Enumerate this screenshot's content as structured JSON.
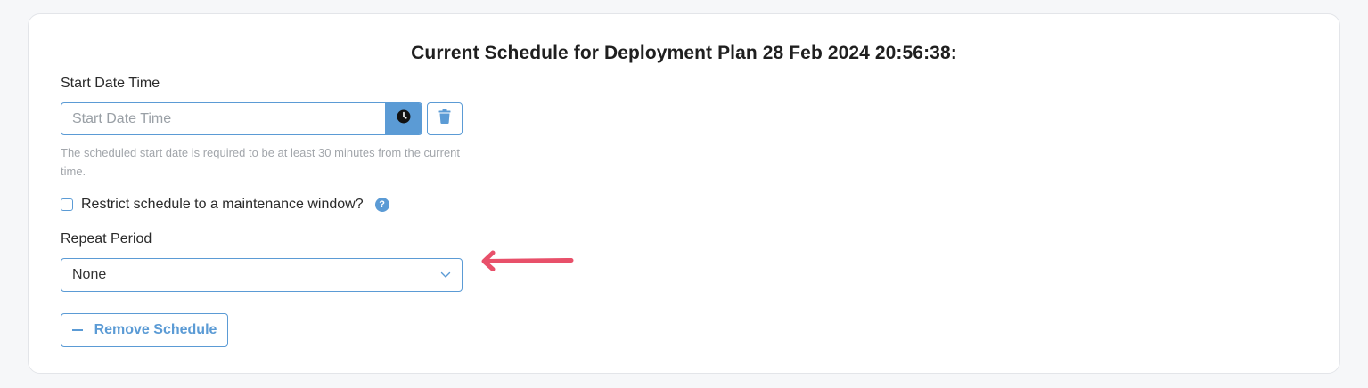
{
  "page": {
    "title": "Current Schedule for Deployment Plan 28 Feb 2024 20:56:38:"
  },
  "start_date": {
    "label": "Start Date Time",
    "placeholder": "Start Date Time",
    "value": "",
    "clock_icon": "clock-icon",
    "trash_icon": "trash-icon",
    "help_text": "The scheduled start date is required to be at least 30 minutes from the current time."
  },
  "maintenance": {
    "label": "Restrict schedule to a maintenance window?",
    "checked": false,
    "help_icon": "question-circle-icon",
    "help_glyph": "?"
  },
  "repeat": {
    "label": "Repeat Period",
    "value": "None",
    "chevron_icon": "chevron-down-icon"
  },
  "actions": {
    "remove_label": "Remove Schedule",
    "remove_icon": "minus-icon"
  },
  "annotation": {
    "arrow_icon": "arrow-left-icon",
    "arrow_color": "#e8506a"
  },
  "colors": {
    "accent": "#5b9bd5",
    "help_text": "#a2a6ab"
  }
}
